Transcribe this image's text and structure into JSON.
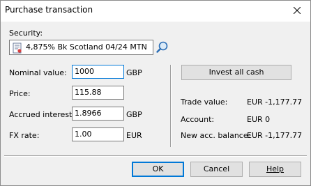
{
  "window": {
    "title": "Purchase transaction"
  },
  "security": {
    "label": "Security:",
    "value": "4,875% Bk Scotland 04/24 MTN"
  },
  "fields": {
    "nominal": {
      "label": "Nominal value:",
      "value": "1000",
      "unit": "GBP"
    },
    "price": {
      "label": "Price:",
      "value": "115.88"
    },
    "accrued": {
      "label": "Accrued interest:",
      "value": "1.8966",
      "unit": "GBP"
    },
    "fx": {
      "label": "FX rate:",
      "value": "1.00",
      "unit": "EUR"
    }
  },
  "invest_button": "Invest all cash",
  "summary": {
    "trade": {
      "label": "Trade value:",
      "value": "EUR  -1,177.77"
    },
    "account": {
      "label": "Account:",
      "value": "EUR  0"
    },
    "balance": {
      "label": "New acc. balance:",
      "value": "EUR  -1,177.77"
    }
  },
  "buttons": {
    "ok": "OK",
    "cancel": "Cancel",
    "help": "Help"
  },
  "icons": {
    "close": "close-icon",
    "security": "document-icon",
    "search": "magnifier-icon"
  }
}
